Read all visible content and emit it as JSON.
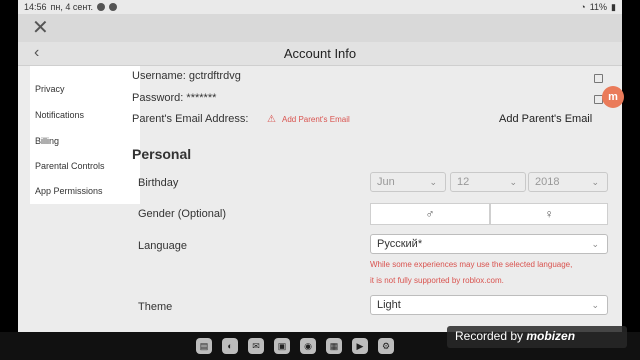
{
  "status": {
    "time": "14:56",
    "date": "пн, 4 сент.",
    "battery": "11%"
  },
  "header": {
    "title": "Account Info"
  },
  "sidebar": {
    "items": [
      {
        "label": "Privacy"
      },
      {
        "label": "Notifications"
      },
      {
        "label": "Billing"
      },
      {
        "label": "Parental Controls"
      },
      {
        "label": "App Permissions"
      }
    ]
  },
  "account": {
    "username": "Username: gctrdftrdvg",
    "password": "Password: *******",
    "parent_email_label": "Parent's Email Address:",
    "add_parent_email_link": "Add Parent's Email",
    "add_parent_email_button": "Add Parent's Email"
  },
  "personal": {
    "section_title": "Personal",
    "birthday_label": "Birthday",
    "birthday": {
      "month": "Jun",
      "day": "12",
      "year": "2018"
    },
    "gender_label": "Gender (Optional)",
    "language_label": "Language",
    "language_value": "Русский*",
    "language_warning_1": "While some experiences may use the selected language,",
    "language_warning_2": "it is not fully supported by roblox.com.",
    "theme_label": "Theme",
    "theme_value": "Light"
  },
  "icons": {
    "close": "close-icon",
    "back": "chevron-left-icon",
    "edit": "edit-icon",
    "warning": "warning-icon",
    "male": "male-icon",
    "female": "female-icon"
  },
  "overlay": {
    "recorded_prefix": "Recorded by",
    "recorded_brand": "mobizen"
  },
  "colors": {
    "warning": "#d9534f",
    "badge": "#ea7b5a"
  }
}
